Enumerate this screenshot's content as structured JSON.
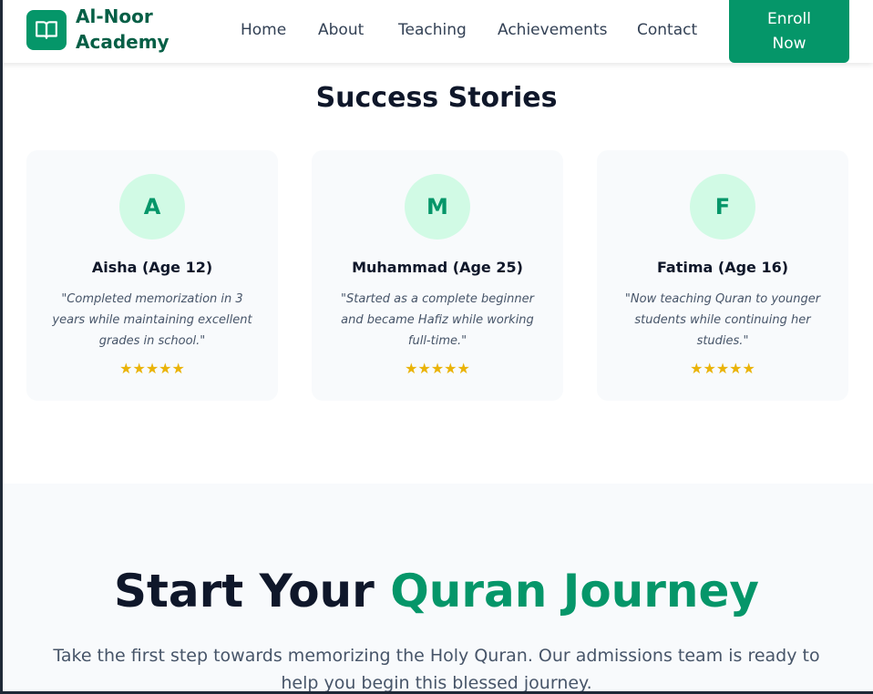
{
  "header": {
    "brand": "Al-Noor Academy",
    "brand_line1": "Al-Noor",
    "brand_line2": "Academy",
    "logo_icon": "open-book-icon",
    "nav": [
      {
        "label": "Home"
      },
      {
        "label": "About"
      },
      {
        "label": "Teaching"
      },
      {
        "label": "Achievements"
      },
      {
        "label": "Contact"
      }
    ],
    "enroll_label": "Enroll Now"
  },
  "stories": {
    "title": "Success Stories",
    "cards": [
      {
        "initial": "A",
        "name": "Aisha (Age 12)",
        "quote": "\"Completed memorization in 3 years while maintaining excellent grades in school.\"",
        "stars": "★★★★★",
        "rating": 5
      },
      {
        "initial": "M",
        "name": "Muhammad (Age 25)",
        "quote": "\"Started as a complete beginner and became Hafiz while working full-time.\"",
        "stars": "★★★★★",
        "rating": 5
      },
      {
        "initial": "F",
        "name": "Fatima (Age 16)",
        "quote": "\"Now teaching Quran to younger students while continuing her studies.\"",
        "stars": "★★★★★",
        "rating": 5
      }
    ]
  },
  "cta": {
    "title_part1": "Start Your ",
    "title_accent": "Quran Journey",
    "text": "Take the first step towards memorizing the Holy Quran. Our admissions team is ready to help you begin this blessed journey."
  },
  "colors": {
    "accent": "#059669",
    "accent_dark": "#065f46",
    "avatar_bg": "#d1fae5",
    "star": "#eab308",
    "card_bg": "#f8fafc"
  }
}
